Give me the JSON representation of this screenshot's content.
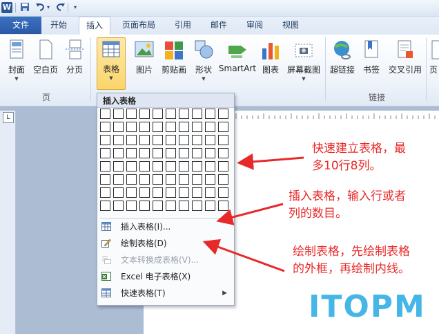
{
  "titlebar": {
    "word_logo": "W",
    "qa_sep": "|"
  },
  "tabs": [
    {
      "label": "文件"
    },
    {
      "label": "开始"
    },
    {
      "label": "插入"
    },
    {
      "label": "页面布局"
    },
    {
      "label": "引用"
    },
    {
      "label": "邮件"
    },
    {
      "label": "审阅"
    },
    {
      "label": "视图"
    }
  ],
  "ribbon": {
    "buttons": [
      {
        "label": "封面",
        "icon": "cover-page-icon",
        "dropdown": true
      },
      {
        "label": "空白页",
        "icon": "blank-page-icon",
        "dropdown": false
      },
      {
        "label": "分页",
        "icon": "page-break-icon",
        "dropdown": false
      },
      {
        "label": "表格",
        "icon": "table-icon",
        "dropdown": true
      },
      {
        "label": "图片",
        "icon": "picture-icon",
        "dropdown": false
      },
      {
        "label": "剪贴画",
        "icon": "clip-art-icon",
        "dropdown": false
      },
      {
        "label": "形状",
        "icon": "shapes-icon",
        "dropdown": true
      },
      {
        "label": "SmartArt",
        "icon": "smartart-icon",
        "dropdown": false
      },
      {
        "label": "图表",
        "icon": "chart-icon",
        "dropdown": false
      },
      {
        "label": "屏幕截图",
        "icon": "screenshot-icon",
        "dropdown": true
      },
      {
        "label": "超链接",
        "icon": "hyperlink-icon",
        "dropdown": false
      },
      {
        "label": "书签",
        "icon": "bookmark-icon",
        "dropdown": false
      },
      {
        "label": "交叉引用",
        "icon": "cross-reference-icon",
        "dropdown": false
      },
      {
        "label": "页",
        "icon": "header-icon",
        "dropdown": false
      }
    ],
    "groups": [
      {
        "label": "页"
      },
      {
        "label": "链接"
      }
    ]
  },
  "panel": {
    "title": "插入表格",
    "grid": {
      "rows": 8,
      "cols": 10
    },
    "items": [
      {
        "label": "插入表格(I)...",
        "icon": "insert-table-icon",
        "disabled": false,
        "submenu": false
      },
      {
        "label": "绘制表格(D)",
        "icon": "draw-table-icon",
        "disabled": false,
        "submenu": false
      },
      {
        "label": "文本转换成表格(V)...",
        "icon": "text-to-table-icon",
        "disabled": true,
        "submenu": false
      },
      {
        "label": "Excel 电子表格(X)",
        "icon": "excel-icon",
        "disabled": false,
        "submenu": false
      },
      {
        "label": "快速表格(T)",
        "icon": "quick-tables-icon",
        "disabled": false,
        "submenu": true
      }
    ]
  },
  "annotations": [
    {
      "lines": [
        "快速建立表格，最",
        "多10行8列。"
      ]
    },
    {
      "lines": [
        "插入表格，输入行或者",
        "列的数目。"
      ]
    },
    {
      "lines": [
        "绘制表格，先绘制表格",
        "的外框，再绘制内线。"
      ]
    }
  ],
  "colors": {
    "annotation": "#e8292a",
    "accent": "#2a5aa6",
    "watermark": "#45b6e6"
  },
  "watermark": "ITOPM"
}
